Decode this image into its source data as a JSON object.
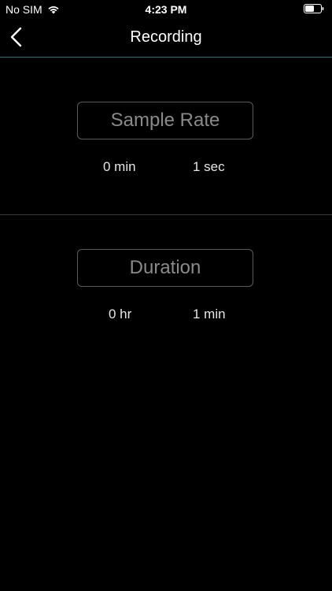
{
  "status_bar": {
    "carrier": "No SIM",
    "time": "4:23 PM",
    "wifi_icon": "wifi-icon",
    "battery_icon": "battery-icon"
  },
  "nav": {
    "title": "Recording",
    "back_icon": "chevron-left-icon",
    "accent_color": "#1f6f86"
  },
  "sample_rate": {
    "label": "Sample Rate",
    "minutes": "0 min",
    "seconds": "1 sec"
  },
  "duration": {
    "label": "Duration",
    "hours": "0 hr",
    "minutes": "1 min"
  }
}
